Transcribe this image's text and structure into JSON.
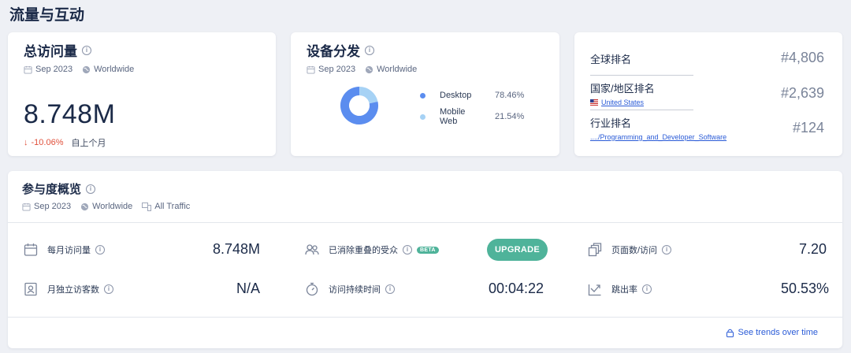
{
  "section_title": "流量与互动",
  "visits": {
    "title": "总访问量",
    "date": "Sep 2023",
    "region": "Worldwide",
    "value": "8.748M",
    "change": "-10.06%",
    "change_label": "自上个月"
  },
  "devices": {
    "title": "设备分发",
    "date": "Sep 2023",
    "region": "Worldwide",
    "items": [
      {
        "name": "Desktop",
        "pct": "78.46%",
        "value": 78.46,
        "color": "#5b8def"
      },
      {
        "name": "Mobile Web",
        "pct": "21.54%",
        "value": 21.54,
        "color": "#a6d2f5"
      }
    ]
  },
  "ranks": {
    "global_label": "全球排名",
    "global_value": "#4,806",
    "country_label": "国家/地区排名",
    "country_name": "United States",
    "country_value": "#2,639",
    "industry_label": "行业排名",
    "industry_name": "..../Programming_and_Developer_Software",
    "industry_value": "#124"
  },
  "engagement": {
    "title": "参与度概览",
    "date": "Sep 2023",
    "region": "Worldwide",
    "traffic": "All Traffic",
    "monthly_visits_label": "每月访问量",
    "monthly_visits_value": "8.748M",
    "unique_visitors_label": "月独立访客数",
    "unique_visitors_value": "N/A",
    "dedup_label": "已消除重叠的受众",
    "beta": "BETA",
    "upgrade": "UPGRADE",
    "duration_label": "访问持续时间",
    "duration_value": "00:04:22",
    "pages_label": "页面数/访问",
    "pages_value": "7.20",
    "bounce_label": "跳出率",
    "bounce_value": "50.53%",
    "trends_link": "See trends over time"
  }
}
